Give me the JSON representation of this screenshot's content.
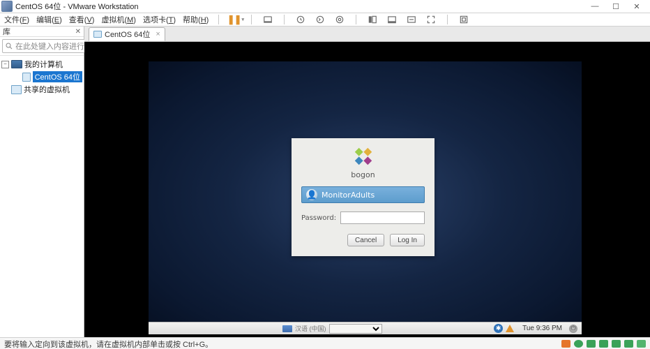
{
  "app": {
    "title_text": "CentOS 64位 - VMware Workstation"
  },
  "menu": {
    "file": {
      "label": "文件(",
      "hot": "F",
      "tail": ")"
    },
    "edit": {
      "label": "编辑(",
      "hot": "E",
      "tail": ")"
    },
    "view": {
      "label": "查看(",
      "hot": "V",
      "tail": ")"
    },
    "vm": {
      "label": "虚拟机(",
      "hot": "M",
      "tail": ")"
    },
    "tabs": {
      "label": "选项卡(",
      "hot": "T",
      "tail": ")"
    },
    "help": {
      "label": "帮助(",
      "hot": "H",
      "tail": ")"
    }
  },
  "library": {
    "title": "库",
    "search_placeholder": "在此处键入内容进行搜…",
    "root": "我的计算机",
    "vm": "CentOS 64位",
    "shared": "共享的虚拟机"
  },
  "tab": {
    "label": "CentOS 64位"
  },
  "login": {
    "hostname": "bogon",
    "username": "MonitorAdults",
    "password_label": "Password:",
    "cancel": "Cancel",
    "login": "Log In"
  },
  "panel": {
    "input_method": "汉语 (中国)",
    "clock": "Tue  9:36 PM"
  },
  "footer": {
    "hint": "要将输入定向到该虚拟机，请在虚拟机内部单击或按 Ctrl+G。"
  }
}
